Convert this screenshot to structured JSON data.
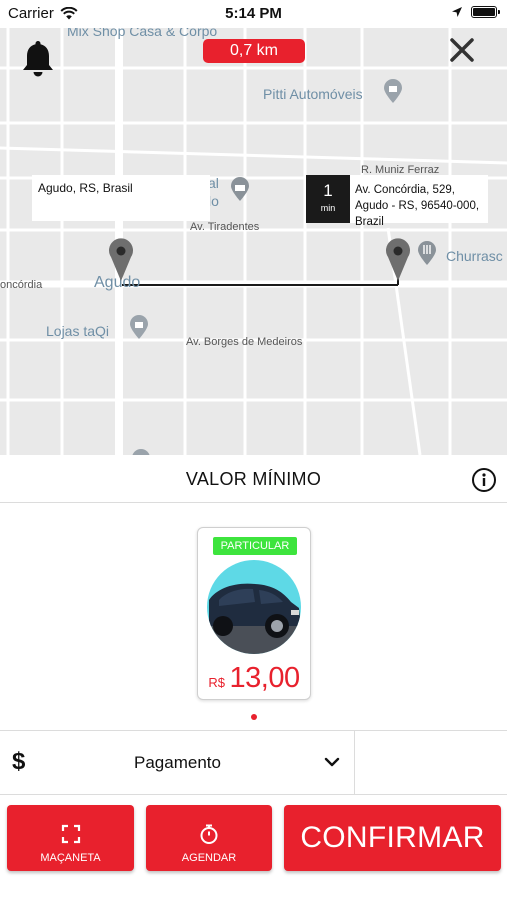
{
  "status_bar": {
    "carrier": "Carrier",
    "time": "5:14 PM"
  },
  "map": {
    "distance": "0,7 km",
    "origin_address": "Agudo, RS, Brasil",
    "eta_value": "1",
    "eta_unit": "min",
    "destination_address": "Av. Concórdia, 529, Agudo - RS, 96540-000, Brazil",
    "labels": {
      "mix_shop": "Mix Shop Casa & Corpo",
      "pitti": "Pitti Automóveis",
      "r_muniz": "R. Muniz Ferraz",
      "av_tiradentes": "Av. Tiradentes",
      "agudo": "Agudo",
      "concordia": "oncórdia",
      "lojas": "Lojas taQi",
      "borges": "Av. Borges de Medeiros",
      "churrasco": "Churrasc",
      "al": "al",
      "lo": "lo"
    }
  },
  "panel": {
    "title": "VALOR MÍNIMO"
  },
  "vehicle_card": {
    "badge": "PARTICULAR",
    "currency": "R$",
    "price": "13,00"
  },
  "payment": {
    "symbol": "$",
    "label": "Pagamento"
  },
  "buttons": {
    "macaneta": "MAÇANETA",
    "agendar": "AGENDAR",
    "confirmar": "CONFIRMAR"
  },
  "colors": {
    "accent": "#e8212d",
    "badge": "#3de43d"
  }
}
